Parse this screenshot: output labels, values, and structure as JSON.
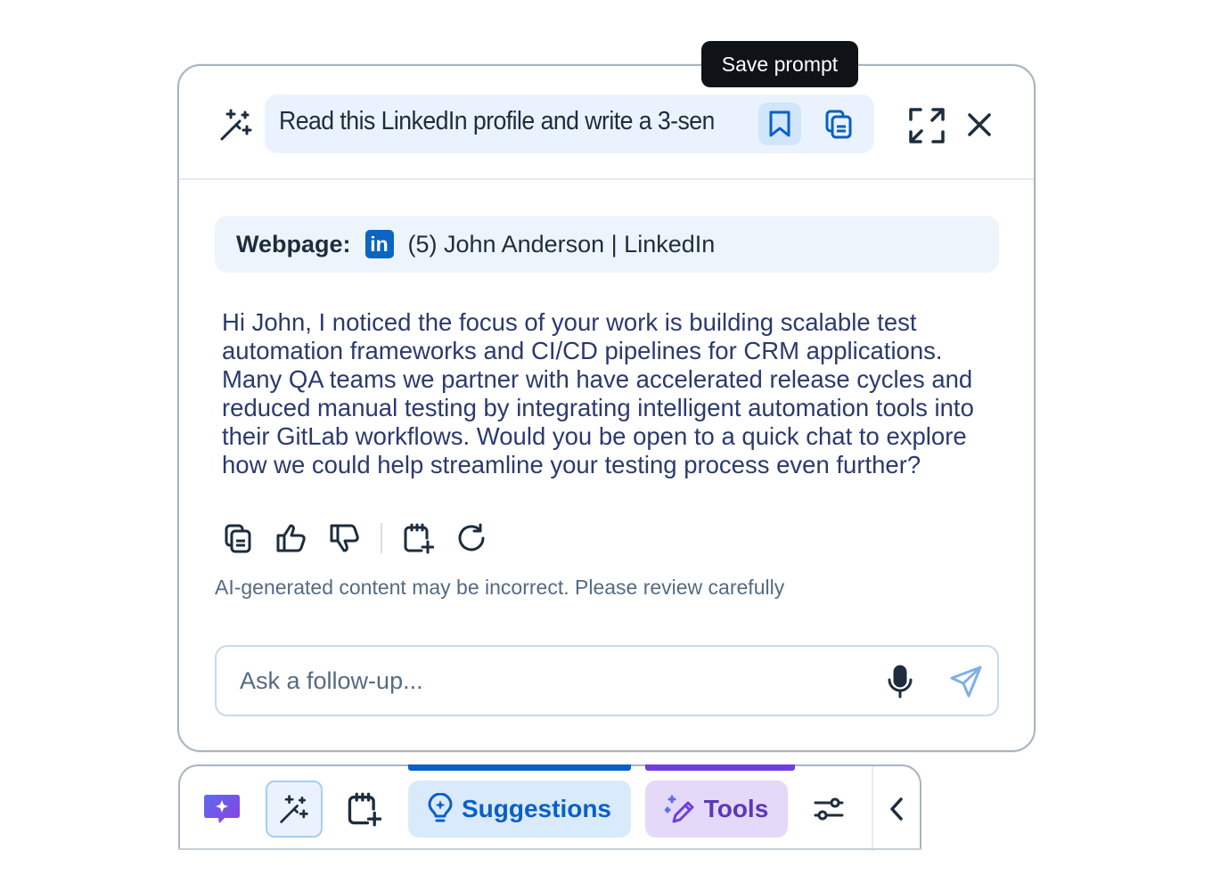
{
  "tooltip": {
    "text": "Save prompt"
  },
  "header": {
    "prompt_text": "Read this LinkedIn profile and write a 3-sen..."
  },
  "webpage": {
    "label": "Webpage:",
    "logo_text": "in",
    "title": "(5) John Anderson | LinkedIn"
  },
  "response": {
    "text": "Hi John, I noticed the focus of your work is building scalable test automation frameworks and CI/CD pipelines for CRM applications. Many QA teams we partner with have accelerated release cycles and reduced manual testing by integrating intelligent automation tools into their GitLab workflows. Would you be open to a quick chat to explore how we could help streamline your testing process even further?"
  },
  "disclaimer": "AI-generated content may be incorrect. Please review carefully",
  "input": {
    "placeholder": "Ask a follow-up..."
  },
  "toolbar": {
    "suggestions_label": "Suggestions",
    "tools_label": "Tools"
  },
  "colors": {
    "accent_blue": "#0a5fc8",
    "accent_purple": "#6f3ee0",
    "linkedin": "#0a66c2"
  }
}
